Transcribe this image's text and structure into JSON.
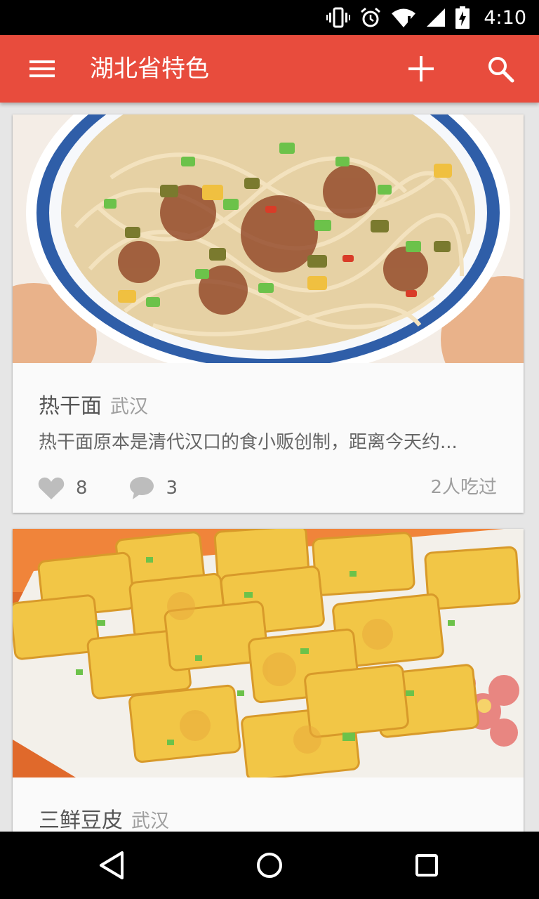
{
  "status_bar": {
    "time": "4:10",
    "icons": [
      "vibrate-icon",
      "alarm-icon",
      "wifi-icon",
      "signal-icon",
      "battery-charging-icon"
    ]
  },
  "toolbar": {
    "title": "湖北省特色",
    "icons": [
      "menu-icon",
      "add-icon",
      "search-icon"
    ]
  },
  "cards": [
    {
      "name": "热干面",
      "city": "武汉",
      "description": "热干面原本是清代汉口的食小贩创制，距离今天约...",
      "likes": "8",
      "comments": "3",
      "eaten": "2人吃过"
    },
    {
      "name": "三鲜豆皮",
      "city": "武汉"
    }
  ],
  "nav_bar": {
    "icons": [
      "back-icon",
      "home-icon",
      "recents-icon"
    ]
  },
  "colors": {
    "toolbar": "#e84c3d",
    "card_bg": "#fafafa",
    "page_bg": "#e6e6e6"
  }
}
